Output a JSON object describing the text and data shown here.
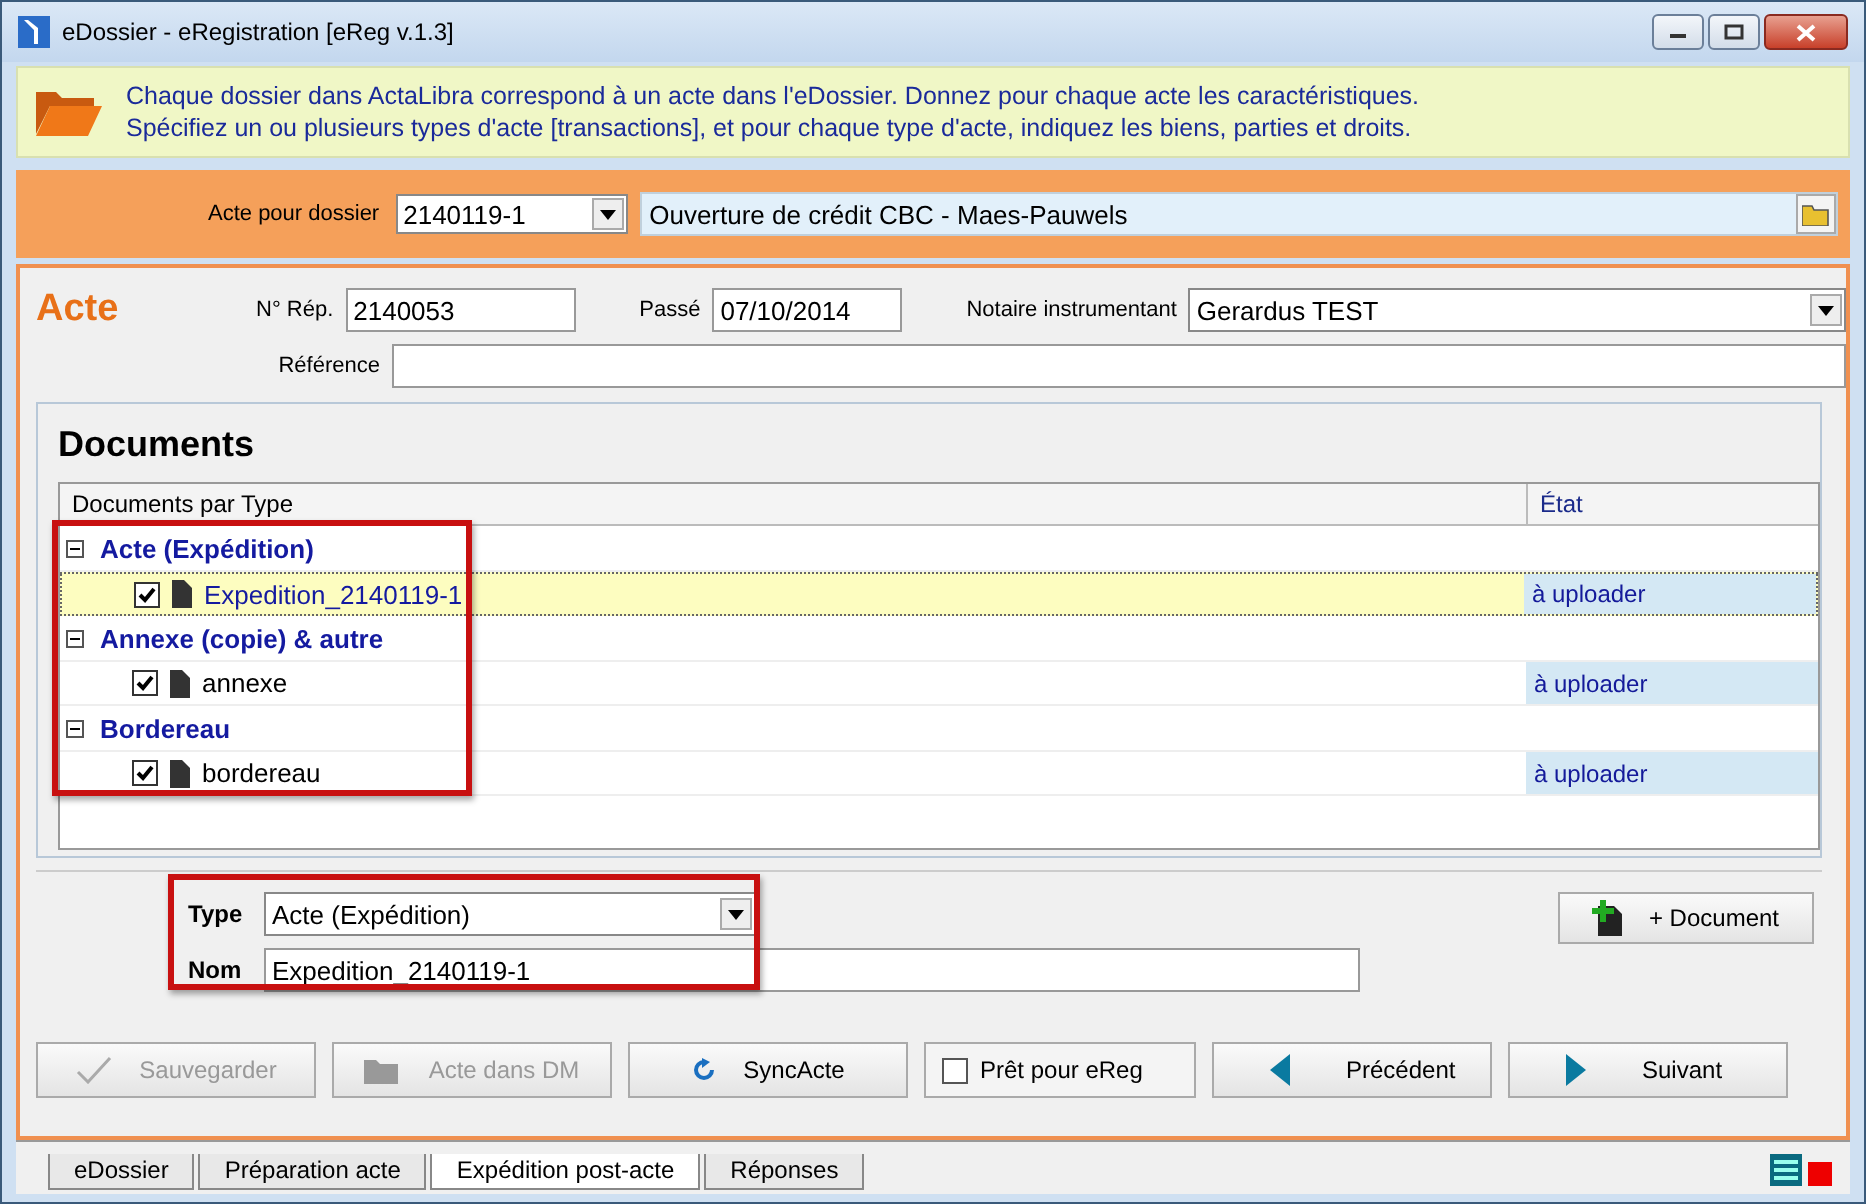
{
  "window": {
    "title": "eDossier - eRegistration [eReg v.1.3]"
  },
  "banner": {
    "lines": [
      "Chaque dossier dans ActaLibra correspond à un acte dans l'eDossier.  Donnez pour chaque acte les caractéristiques.",
      "Spécifiez un ou plusieurs types d'acte [transactions], et pour chaque type d'acte, indiquez les biens, parties et droits."
    ]
  },
  "dossier": {
    "label": "Acte pour dossier",
    "value": "2140119-1",
    "description": "Ouverture de crédit CBC - Maes-Pauwels"
  },
  "acte": {
    "title": "Acte",
    "rep_label": "N° Rép.",
    "rep": "2140053",
    "passe_label": "Passé",
    "passe": "07/10/2014",
    "notaire_label": "Notaire instrumentant",
    "notaire": "Gerardus TEST",
    "reference_label": "Référence"
  },
  "documents": {
    "title": "Documents",
    "columns": [
      "Documents par Type",
      "État"
    ],
    "groups": [
      {
        "label": "Acte (Expédition)",
        "expanded": true,
        "children": [
          {
            "name": "Expedition_2140119-1",
            "checked": true,
            "selected": true,
            "status": "à uploader"
          }
        ]
      },
      {
        "label": "Annexe (copie) & autre",
        "expanded": true,
        "children": [
          {
            "name": "annexe",
            "checked": true,
            "selected": false,
            "status": "à uploader"
          }
        ]
      },
      {
        "label": "Bordereau",
        "expanded": true,
        "children": [
          {
            "name": "bordereau",
            "checked": true,
            "selected": false,
            "status": "à uploader"
          }
        ]
      }
    ]
  },
  "form": {
    "type_label": "Type",
    "type": "Acte (Expédition)",
    "nom_label": "Nom",
    "nom": "Expedition_2140119-1",
    "add_button": "+ Document"
  },
  "actions": [
    {
      "kind": "save",
      "label": "Sauvegarder",
      "disabled": true
    },
    {
      "kind": "folder",
      "label": "Acte dans DM",
      "disabled": true
    },
    {
      "kind": "sync",
      "label": "SyncActe",
      "disabled": false
    },
    {
      "kind": "checkbox",
      "label": "Prêt pour eReg",
      "checked": false
    },
    {
      "kind": "prev",
      "label": "Précédent",
      "disabled": false
    },
    {
      "kind": "next",
      "label": "Suivant",
      "disabled": false
    }
  ],
  "tabs": [
    {
      "label": "eDossier",
      "selected": false
    },
    {
      "label": "Préparation acte",
      "selected": false
    },
    {
      "label": "Expédition post-acte",
      "selected": true
    },
    {
      "label": "Réponses",
      "selected": false
    }
  ]
}
